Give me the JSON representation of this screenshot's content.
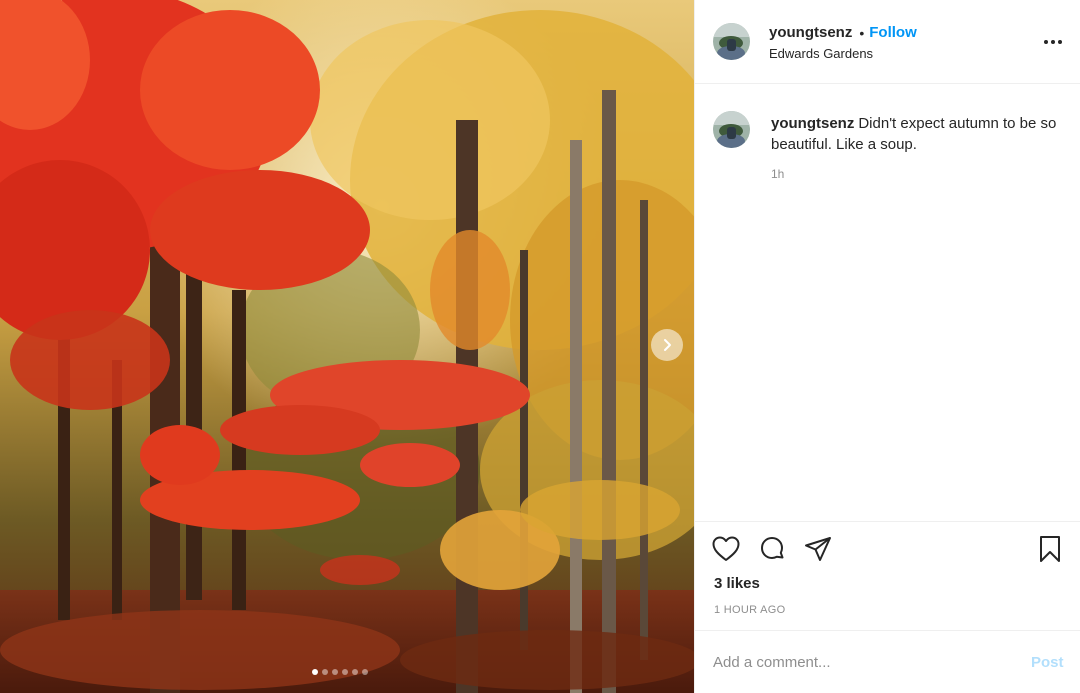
{
  "post": {
    "username": "youngtsenz",
    "follow_label": "Follow",
    "separator": "•",
    "location": "Edwards Gardens",
    "caption_text": "Didn't expect autumn to be so beautiful. Like a soup.",
    "caption_time": "1h",
    "likes": "3 likes",
    "post_time": "1 HOUR AGO",
    "comment_placeholder": "Add a comment...",
    "post_button": "Post"
  },
  "carousel": {
    "current_index": 1,
    "total_images": 6
  },
  "colors": {
    "accent": "#0095f6",
    "post_disabled": "#b2dffc",
    "text_primary": "#262626",
    "text_secondary": "#8e8e8e"
  },
  "icons": {
    "more": "more-options-icon",
    "next": "chevron-right-icon",
    "like": "heart-icon",
    "comment": "comment-bubble-icon",
    "share": "paper-plane-icon",
    "save": "bookmark-icon"
  }
}
